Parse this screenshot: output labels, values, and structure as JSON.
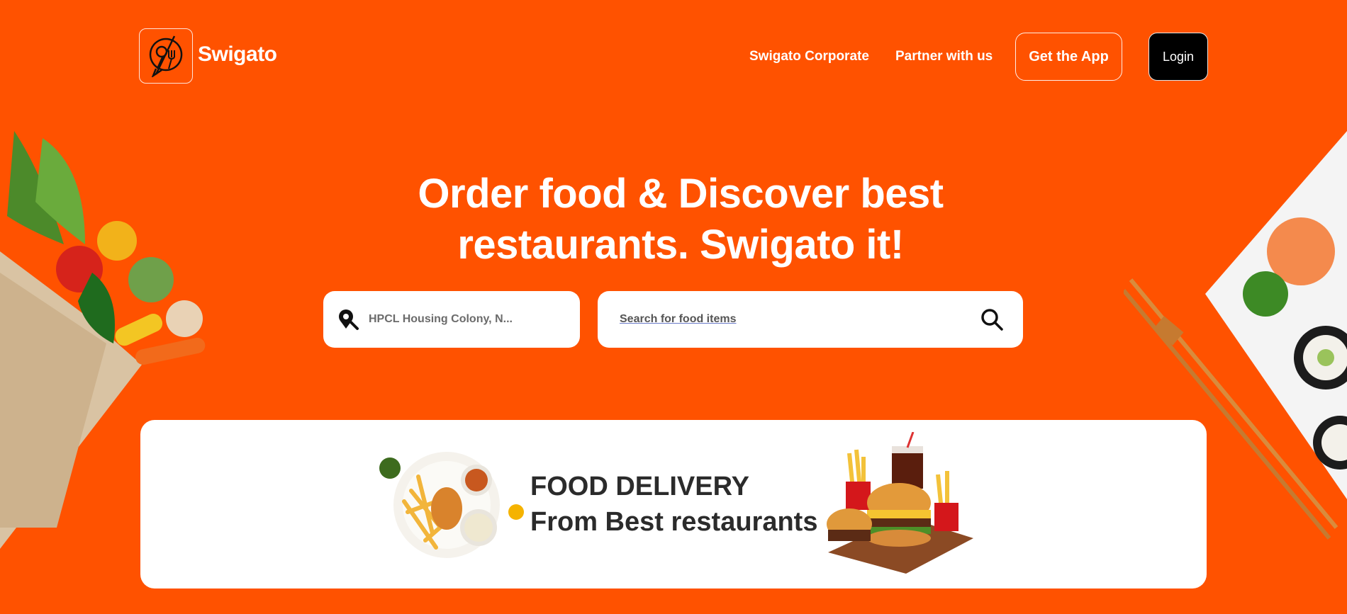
{
  "brand": {
    "name": "Swigato",
    "logo_icon": "fork-spoon-chat-icon"
  },
  "nav": {
    "corporate": "Swigato Corporate",
    "partner": "Partner with us",
    "get_app": "Get the App",
    "login": "Login"
  },
  "hero": {
    "title_line1": "Order food & Discover best",
    "title_line2": "restaurants. Swigato it!"
  },
  "location": {
    "value": "HPCL Housing Colony, N...",
    "icon": "location-pin-icon"
  },
  "search": {
    "placeholder": "Search for food items",
    "icon": "search-icon"
  },
  "promo": {
    "line1": "FOOD DELIVERY",
    "line2": "From Best restaurants"
  },
  "colors": {
    "brand_orange": "#FF5200",
    "login_bg": "#000000",
    "card_bg": "#FFFFFF",
    "promo_text": "#2B2B2B"
  }
}
